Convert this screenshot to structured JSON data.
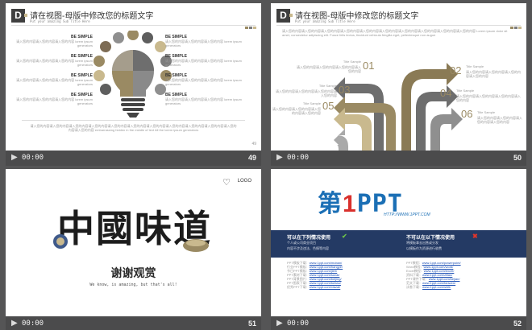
{
  "slides": [
    {
      "header": {
        "logo": "D",
        "title": "请在视图-母版中修改您的标题文字",
        "subtitle": "Put your amazing Sub Title Here"
      },
      "left_items": [
        {
          "title": "BE SIMPLE",
          "text": "请入您的内容请入您的内容请入您的内容 lorem ipsum generators"
        },
        {
          "title": "BE SIMPLE",
          "text": "请入您的内容请入您的内容请入您的内容 lorem ipsum generators"
        },
        {
          "title": "BE SIMPLE",
          "text": "请入您的内容请入您的内容请入您的内容 lorem ipsum generators"
        },
        {
          "title": "BE SIMPLE",
          "text": "请入您的内容请入您的内容请入您的内容 lorem ipsum generators"
        }
      ],
      "right_items": [
        {
          "title": "BE SIMPLE",
          "text": "请入您的内容请入您的内容请入您的内容 lorem ipsum generators"
        },
        {
          "title": "BE SIMPLE",
          "text": "请入您的内容请入您的内容请入您的内容 lorem ipsum generators"
        },
        {
          "title": "BE SIMPLE",
          "text": "请入您的内容请入您的内容请入您的内容 lorem ipsum generators"
        },
        {
          "title": "BE SIMPLE",
          "text": "请入您的内容请入您的内容请入您的内容 lorem ipsum generators"
        }
      ],
      "footer_text": "请入您的内容请入您的内容请入您的内容请入您的内容请入您的内容请入您的内容请入您的内容请入您的内容请入您的内容请入您的内容请入您的内容请入您的内容 embarrassing hidden in the middle of text All the lorem ipsum generators",
      "page_mark": "49",
      "time": "00:00",
      "number": "49"
    },
    {
      "header": {
        "logo": "D",
        "title": "请在视图-母版中修改您的标题文字",
        "subtitle": "Put your amazing Sub Title Here"
      },
      "intro": "请入您的内容请入您的内容请入您的内容请入您的内容请入您的内容请入您的内容请入您的内容请入您的内容请入您的内容请入您的内容 Lorem ipsum dolor sit amet, consectetur adipiscing elit. Fusce felis lectus, tincidunt vehicula fringilla eget, pellentesque non augue",
      "samples": [
        {
          "num": "01",
          "title": "Title Sample",
          "text": "请入您的内容请入您的内容请入您的内容请入您的内容"
        },
        {
          "num": "02",
          "title": "Title Sample",
          "text": "请入您的内容请入您的内容请入您的内容请入您的内容"
        },
        {
          "num": "03",
          "title": "Title Sample",
          "text": "请入您的内容请入您的内容请入您的内容请入您的内容"
        },
        {
          "num": "04",
          "title": "Title Sample",
          "text": "请入您的内容请入您的内容请入您的内容请入您的内容"
        },
        {
          "num": "05",
          "title": "Title Sample",
          "text": "请入您的内容请入您的内容请入您的内容请入您的内容"
        },
        {
          "num": "06",
          "title": "Title Sample",
          "text": "请入您的内容请入您的内容请入您的内容请入您的内容"
        }
      ],
      "page_mark": "50",
      "time": "00:00",
      "number": "50"
    },
    {
      "logo_text": "LOGO",
      "calligraphy": "中國味道",
      "thanks": "谢谢观赏",
      "tagline": "We know, is amazing, but that's all!",
      "time": "00:00",
      "number": "51"
    },
    {
      "brand": {
        "prefix": "第",
        "one": "1",
        "ppt": "PPT",
        "url": "HTTP://WWW.1PPT.COM"
      },
      "allowed": {
        "heading": "可以在下列情况使用",
        "items": [
          "个人或公司商业项目",
          "内容不涉及违法、色情等内容"
        ]
      },
      "forbidden": {
        "heading": "不可以在以下情况使用",
        "items": [
          "将模板拿去出售或分发",
          "以模板作为资源进行收费"
        ]
      },
      "links_left": [
        {
          "label": "PPT模板下载：",
          "url": "www.1ppt.com/moban/"
        },
        {
          "label": "行业PPT模板：",
          "url": "www.1ppt.com/hangye/"
        },
        {
          "label": "节日PPT模板：",
          "url": "www.1ppt.com/jieri/"
        },
        {
          "label": "PPT素材下载：",
          "url": "www.1ppt.com/sucai/"
        },
        {
          "label": "PPT背景图片：",
          "url": "www.1ppt.com/beijing/"
        },
        {
          "label": "PPT图表下载：",
          "url": "www.1ppt.com/tubiao/"
        },
        {
          "label": "优秀PPT下载：",
          "url": "www.1ppt.com/xiazai/"
        }
      ],
      "links_right": [
        {
          "label": "PPT教程：",
          "url": "www.1ppt.com/powerpoint/"
        },
        {
          "label": "Word教程：",
          "url": "www.1ppt.com/word/"
        },
        {
          "label": "Excel教程：",
          "url": "www.1ppt.com/excel/"
        },
        {
          "label": "资料下载：",
          "url": "www.1ppt.com/ziliao/"
        },
        {
          "label": "PPT课件下载：",
          "url": "www.1ppt.com/kejian/"
        },
        {
          "label": "范文下载：",
          "url": "www.1ppt.com/fanwen/"
        },
        {
          "label": "试卷下载：",
          "url": "www.1ppt.com/shiti/"
        }
      ],
      "time": "00:00",
      "number": "52"
    }
  ],
  "colors": {
    "accent": "#9a8a63",
    "dark": "#3f3f3f",
    "gray": "#8f8f8f",
    "blue": "#1b6fb5",
    "navy": "#243a64"
  },
  "icons": {
    "play": "play-icon",
    "heart": "heart-logo-icon"
  }
}
